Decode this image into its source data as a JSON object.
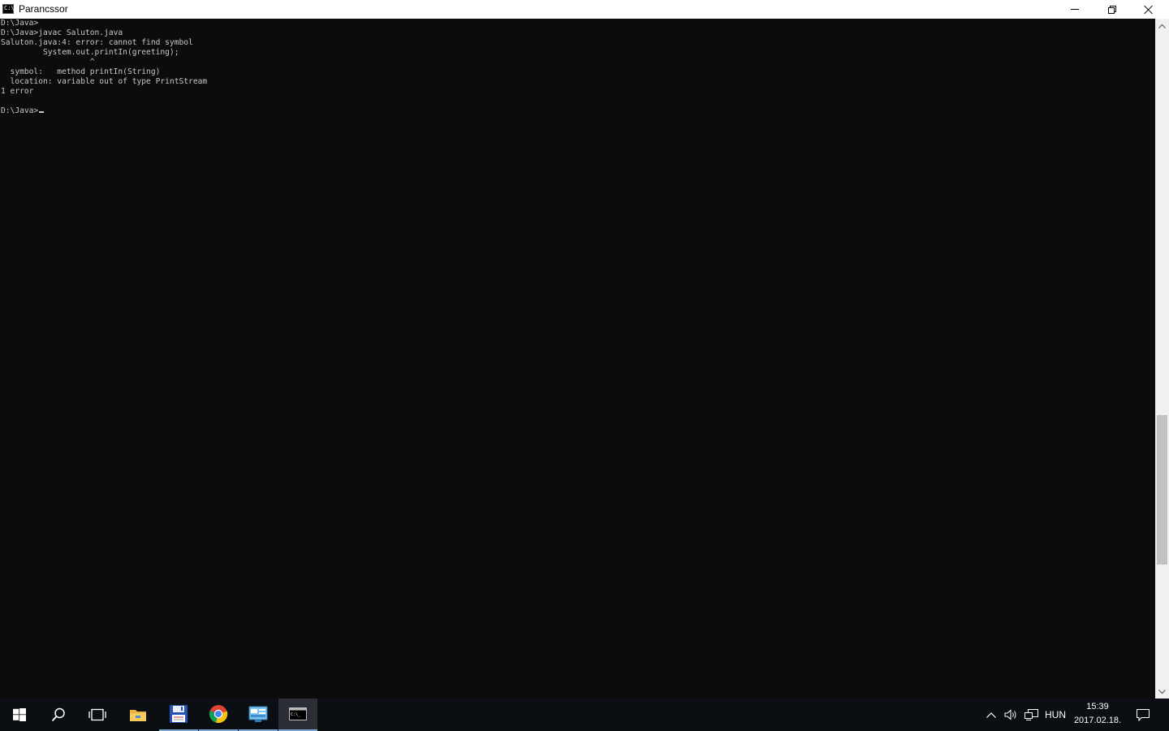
{
  "window": {
    "title": "Parancssor",
    "icon_text": "C:\\",
    "controls": {
      "minimize": "minimize-icon",
      "restore": "restore-icon",
      "close": "close-icon"
    }
  },
  "console": {
    "lines": [
      "D:\\Java>",
      "D:\\Java>javac Saluton.java",
      "Saluton.java:4: error: cannot find symbol",
      "         System.out.printIn(greeting);",
      "                   ^",
      "  symbol:   method printIn(String)",
      "  location: variable out of type PrintStream",
      "1 error",
      "",
      "D:\\Java>"
    ],
    "colors": {
      "background": "#0c0c0c",
      "text": "#c8c8c8"
    }
  },
  "taskbar": {
    "items": [
      {
        "name": "start-icon"
      },
      {
        "name": "search-icon"
      },
      {
        "name": "task-view-icon"
      },
      {
        "name": "file-explorer-icon"
      },
      {
        "name": "save-app-icon"
      },
      {
        "name": "chrome-icon"
      },
      {
        "name": "control-panel-icon"
      },
      {
        "name": "command-prompt-icon"
      }
    ],
    "tray": {
      "language": "HUN",
      "time": "15:39",
      "date": "2017.02.18."
    }
  }
}
